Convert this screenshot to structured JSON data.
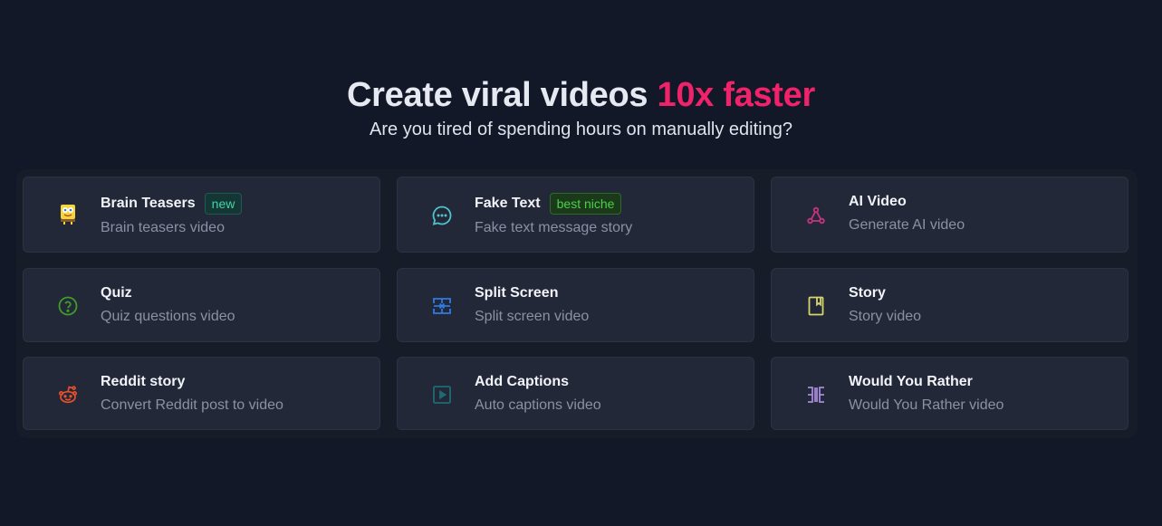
{
  "hero": {
    "headline_main": "Create viral videos ",
    "headline_accent": "10x faster",
    "subheadline": "Are you tired of spending hours on manually editing?"
  },
  "cards": [
    {
      "title": "Brain Teasers",
      "badge": "new",
      "desc": "Brain teasers video",
      "icon": "sponge-character-icon"
    },
    {
      "title": "Fake Text",
      "badge": "best niche",
      "desc": "Fake text message story",
      "icon": "chat-bubble-icon"
    },
    {
      "title": "AI Video",
      "desc": "Generate AI video",
      "icon": "network-nodes-icon"
    },
    {
      "title": "Quiz",
      "desc": "Quiz questions video",
      "icon": "question-circle-icon"
    },
    {
      "title": "Split Screen",
      "desc": "Split screen video",
      "icon": "split-screen-icon"
    },
    {
      "title": "Story",
      "desc": "Story video",
      "icon": "book-icon"
    },
    {
      "title": "Reddit story",
      "desc": "Convert Reddit post to video",
      "icon": "reddit-icon"
    },
    {
      "title": "Add Captions",
      "desc": "Auto captions video",
      "icon": "play-square-icon"
    },
    {
      "title": "Would You Rather",
      "desc": "Would You Rather video",
      "icon": "compare-columns-icon"
    }
  ],
  "colors": {
    "background": "#121827",
    "card": "#232839",
    "accent": "#f0226a",
    "badge_new": "#3fd6a8",
    "badge_best_niche": "#4bd04b"
  }
}
